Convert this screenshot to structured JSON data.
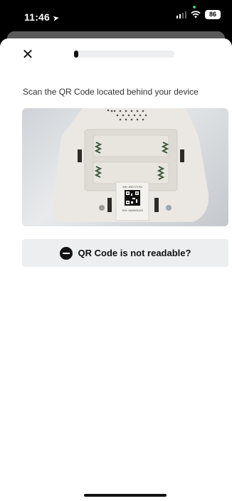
{
  "status_bar": {
    "time": "11:46",
    "battery": "86"
  },
  "header": {
    "close_icon": "close-icon",
    "progress_fraction": 0.04
  },
  "content": {
    "instruction": "Scan the QR Code located behind your device",
    "photo_label_line1": "MD: 8907717M",
    "photo_label_line2": "S/N: 0A2603123"
  },
  "qr_help_button": {
    "icon": "minus-circle-icon",
    "label": "QR Code is not readable?"
  },
  "colors": {
    "accent": "#111111",
    "button_bg": "#eceeef",
    "progress_track": "#eceeef"
  }
}
